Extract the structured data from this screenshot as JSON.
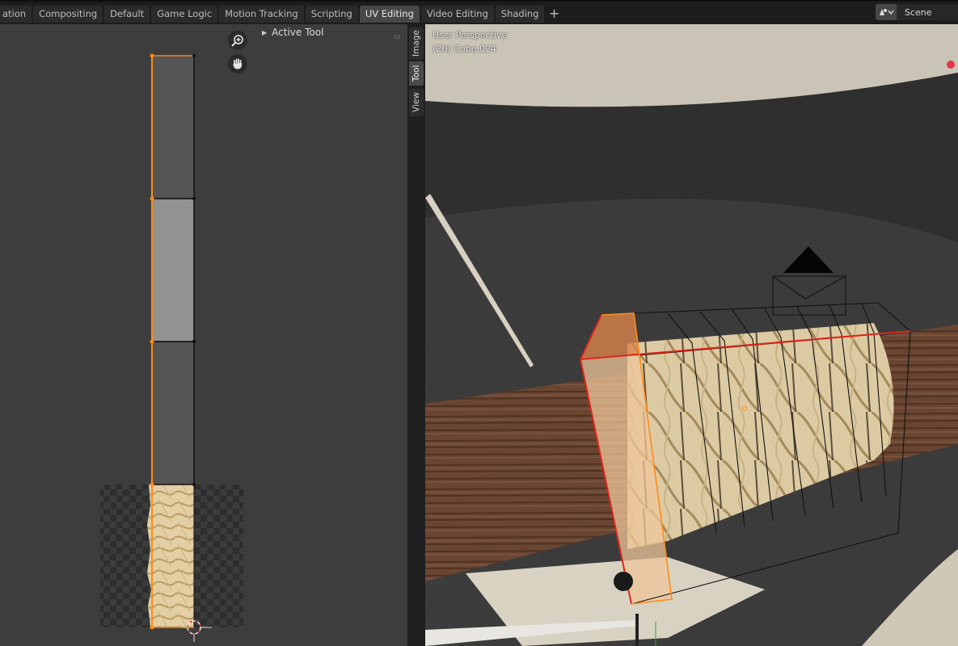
{
  "workspace_tabs": [
    {
      "label": "ation"
    },
    {
      "label": "Compositing"
    },
    {
      "label": "Default"
    },
    {
      "label": "Game Logic"
    },
    {
      "label": "Motion Tracking"
    },
    {
      "label": "Scripting"
    },
    {
      "label": "UV Editing",
      "active": true
    },
    {
      "label": "Video Editing"
    },
    {
      "label": "Shading"
    }
  ],
  "add_tab_label": "+",
  "scene": {
    "label": "Scene",
    "icon": "scene-icon"
  },
  "uv_editor": {
    "panel_title": "Active Tool",
    "zoom_icon": "zoom-in-icon",
    "pan_icon": "hand-pan-icon"
  },
  "sidebar_tabs": [
    {
      "label": "Image"
    },
    {
      "label": "Tool",
      "active": true
    },
    {
      "label": "View"
    }
  ],
  "viewport": {
    "perspective_label": "User Perspective",
    "object_label": "(26) Cube.024"
  },
  "colors": {
    "selection_orange": "#ff8c1a",
    "active_edge_red": "#e0241a",
    "ui_dark": "#1d1d1d",
    "uv_background": "#3d3d3d"
  }
}
